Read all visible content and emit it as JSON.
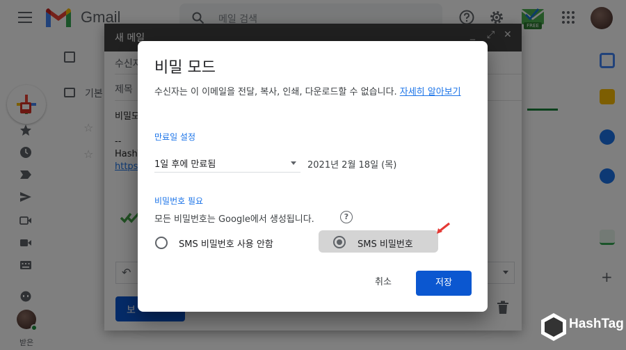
{
  "gmail": {
    "brand": "Gmail",
    "search_placeholder": "메일 검색",
    "addon_badge": "FREE",
    "list_header_label": "기본",
    "sidebar_text": "받은"
  },
  "compose": {
    "title": "새 메일",
    "to_label": "수신자",
    "subject_label": "제목",
    "body_prefix": "비밀모",
    "body_signature_dash": "--",
    "body_signature_name": "HashT",
    "body_link": "https:",
    "send_label": "보"
  },
  "dialog": {
    "title": "비밀 모드",
    "description": "수신자는 이 이메일을 전달, 복사, 인쇄, 다운로드할 수 없습니다.",
    "learn_more": "자세히 알아보기",
    "expiry_section": "만료일 설정",
    "expiry_value": "1일 후에 만료됨",
    "expiry_date": "2021년 2월 18일 (목)",
    "password_section": "비밀번호 필요",
    "password_note": "모든 비밀번호는 Google에서 생성됩니다.",
    "help_glyph": "?",
    "options": [
      {
        "label": "SMS 비밀번호 사용 안함",
        "selected": false
      },
      {
        "label": "SMS 비밀번호",
        "selected": true
      }
    ],
    "cancel_label": "취소",
    "save_label": "저장"
  },
  "watermark": {
    "text": "HashTag"
  },
  "colors": {
    "primary_blue": "#0b57d0",
    "link_blue": "#1a73e8",
    "compose_header": "#404040",
    "annotation_red": "#e53935"
  }
}
